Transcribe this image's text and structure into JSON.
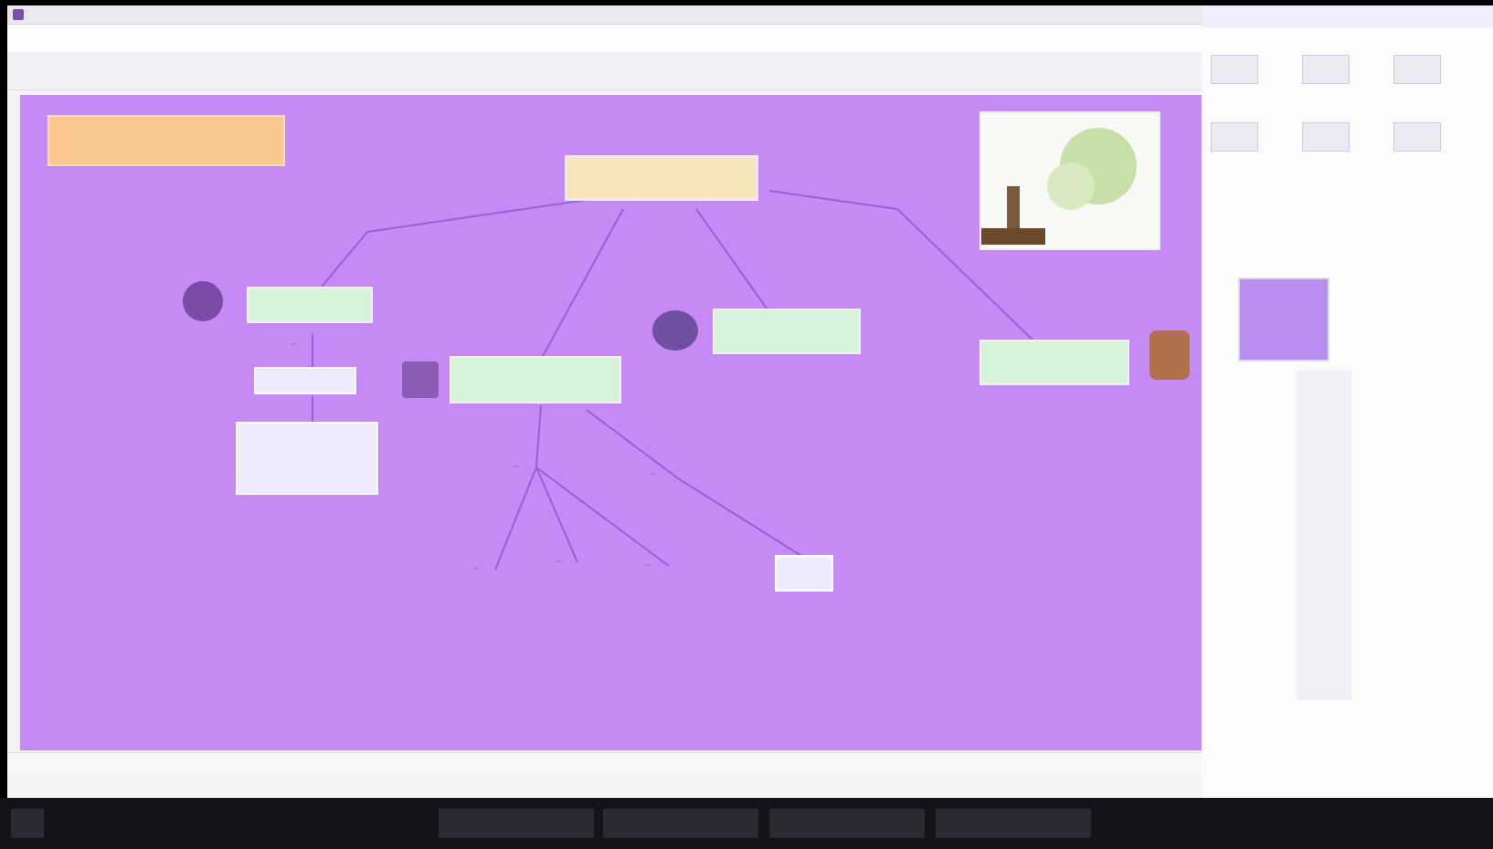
{
  "window": {
    "title": ""
  },
  "menu": {
    "items": []
  },
  "toolbar": {
    "buttons": []
  },
  "map": {
    "root": "",
    "note": "",
    "concepts": [
      "",
      "",
      "",
      ""
    ],
    "subs": [
      "",
      "",
      ""
    ],
    "link_labels": [
      "",
      "",
      "",
      "",
      "",
      ""
    ]
  },
  "side": {
    "header": "",
    "buttons": [],
    "props": []
  },
  "status": {
    "text": ""
  },
  "taskbar": {
    "items": [],
    "clock": ""
  },
  "colors": {
    "canvas": "#c68af4",
    "concept_fill": "#d8f4d8",
    "root_fill": "#f6e6b8",
    "note_fill": "#f8c890"
  }
}
